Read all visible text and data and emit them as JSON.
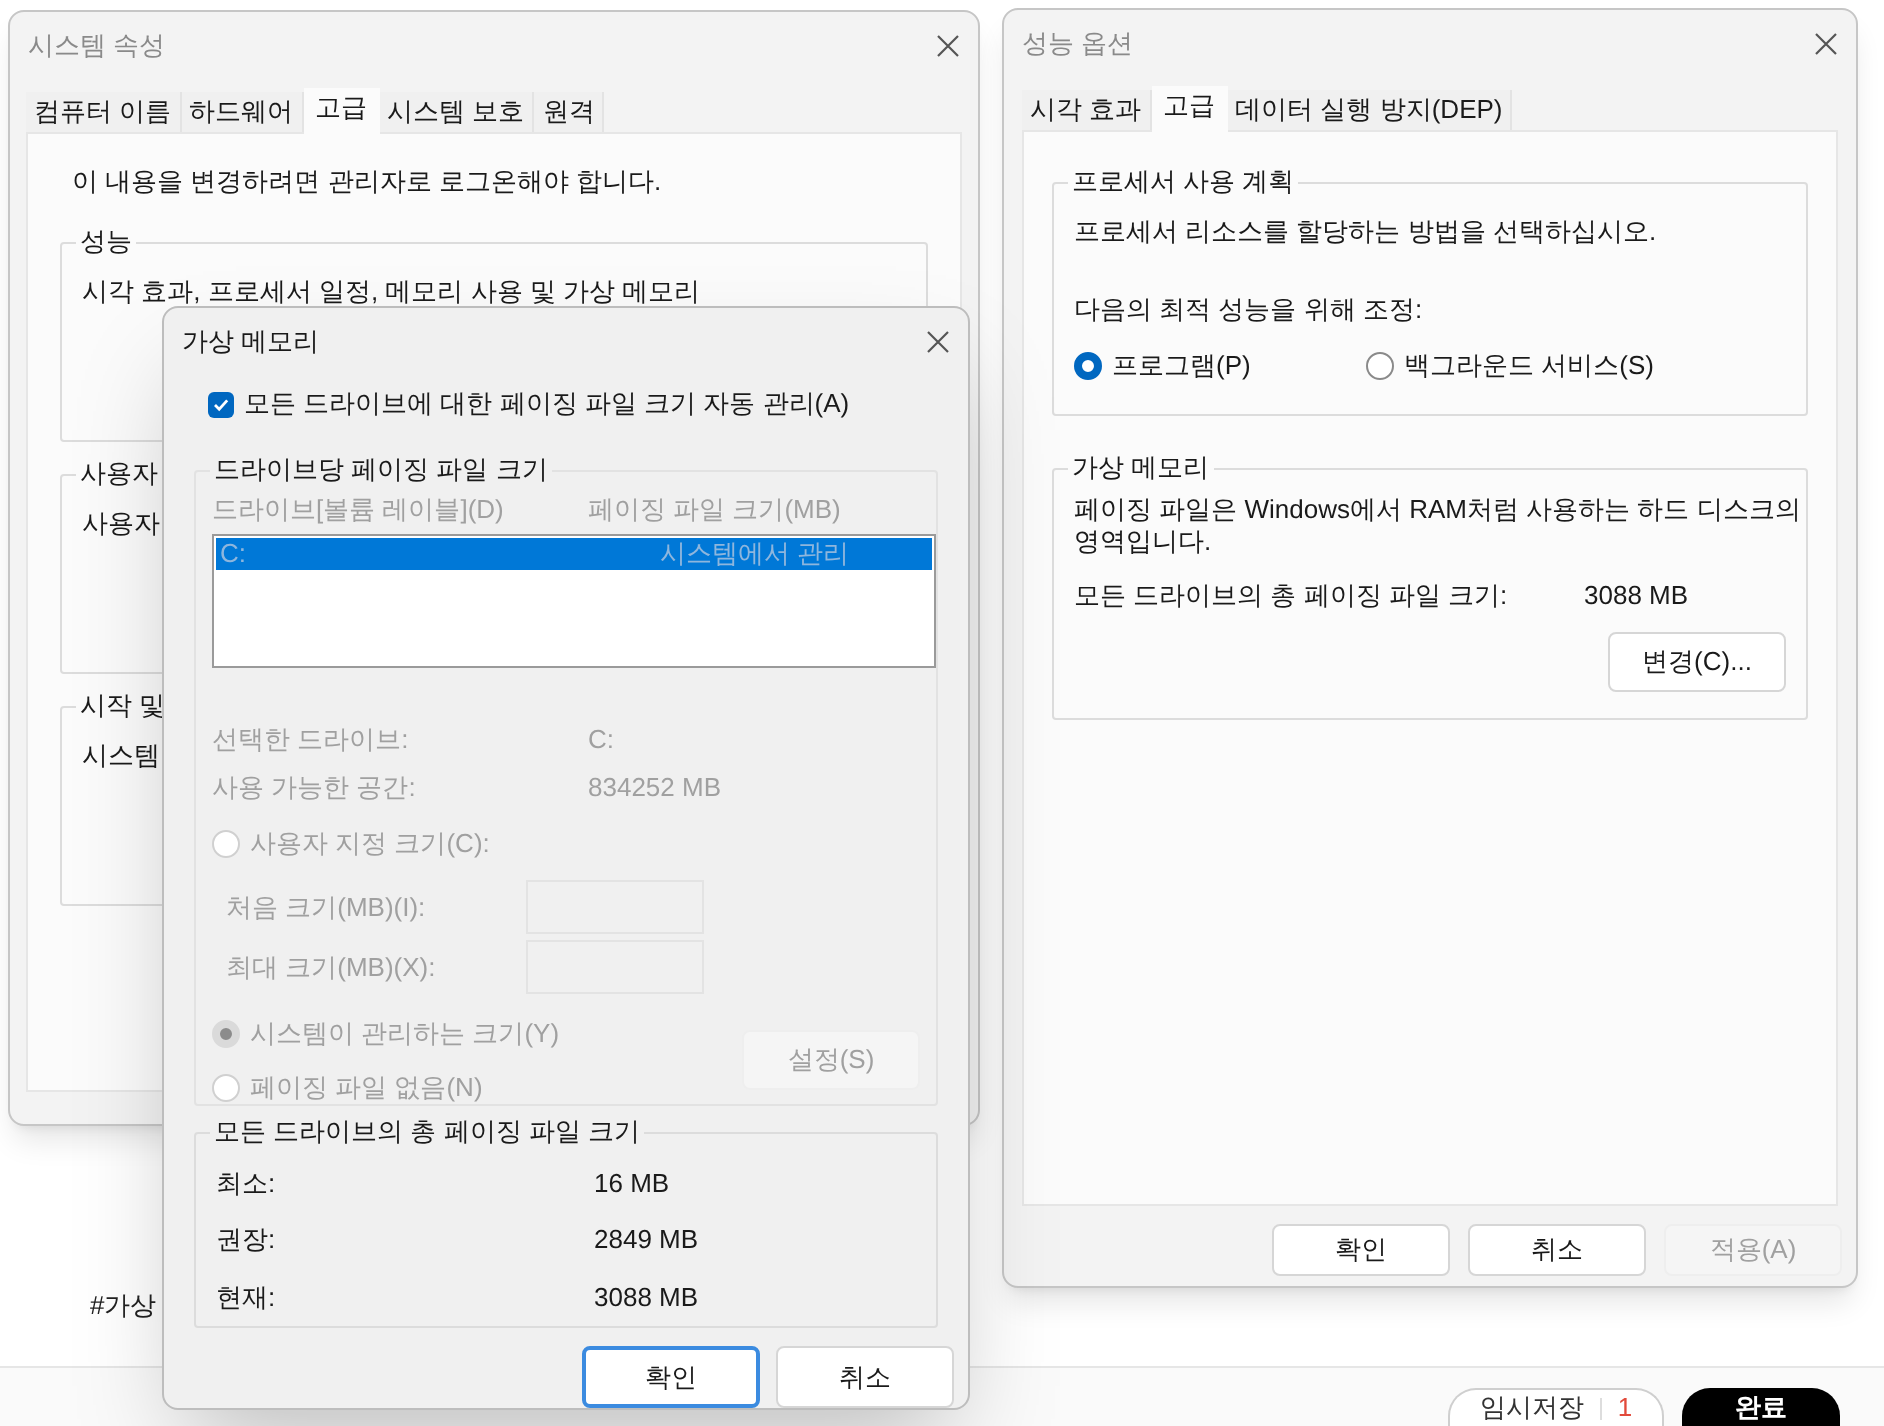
{
  "background": {
    "tag": "#가상",
    "temp_save": "임시저장",
    "temp_count": "1",
    "done": "완료"
  },
  "system_properties": {
    "title": "시스템 속성",
    "active": false,
    "tabs": [
      {
        "label": "컴퓨터 이름",
        "selected": false
      },
      {
        "label": "하드웨어",
        "selected": false
      },
      {
        "label": "고급",
        "selected": true
      },
      {
        "label": "시스템 보호",
        "selected": false
      },
      {
        "label": "원격",
        "selected": false
      }
    ],
    "notice": "이 내용을 변경하려면 관리자로 로그온해야 합니다.",
    "groups": [
      {
        "title": "성능",
        "text": "시각 효과, 프로세서 일정, 메모리 사용 및 가상 메모리"
      },
      {
        "title": "사용자",
        "text": "사용자"
      },
      {
        "title": "시작 및",
        "text": "시스템"
      }
    ]
  },
  "performance_options": {
    "title": "성능 옵션",
    "active": false,
    "tabs": [
      {
        "label": "시각 효과",
        "selected": false
      },
      {
        "label": "고급",
        "selected": true
      },
      {
        "label": "데이터 실행 방지(DEP)",
        "selected": false
      }
    ],
    "processor": {
      "title": "프로세서 사용 계획",
      "text": "프로세서 리소스를 할당하는 방법을 선택하십시오.",
      "adjust_label": "다음의 최적 성능을 위해 조정:",
      "options": [
        {
          "label": "프로그램(P)",
          "selected": true
        },
        {
          "label": "백그라운드 서비스(S)",
          "selected": false
        }
      ]
    },
    "virtual_memory": {
      "title": "가상 메모리",
      "text": "페이징 파일은 Windows에서 RAM처럼 사용하는 하드 디스크의 영역입니다.",
      "total_label": "모든 드라이브의 총 페이징 파일 크기:",
      "total_value": "3088 MB",
      "button": "변경(C)..."
    },
    "buttons": [
      {
        "label": "확인",
        "disabled": false
      },
      {
        "label": "취소",
        "disabled": false
      },
      {
        "label": "적용(A)",
        "disabled": true
      }
    ]
  },
  "virtual_memory": {
    "title": "가상 메모리",
    "active": true,
    "auto_manage": {
      "label": "모든 드라이브에 대한 페이징 파일 크기 자동 관리(A)",
      "checked": true
    },
    "per_drive": {
      "title": "드라이브당 페이징 파일 크기",
      "disabled": true,
      "columns": [
        "드라이브[볼륨 레이블](D)",
        "페이징 파일 크기(MB)"
      ],
      "rows": [
        {
          "drive": "C:",
          "size": "시스템에서 관리",
          "selected": true
        }
      ],
      "info": [
        {
          "label": "선택한 드라이브:",
          "value": "C:"
        },
        {
          "label": "사용 가능한 공간:",
          "value": "834252 MB"
        }
      ],
      "custom": {
        "label": "사용자 지정 크기(C):",
        "selected": false
      },
      "fields": [
        {
          "label": "처음 크기(MB)(I):"
        },
        {
          "label": "최대 크기(MB)(X):"
        }
      ],
      "options": [
        {
          "label": "시스템이 관리하는 크기(Y)",
          "selected": true
        },
        {
          "label": "페이징 파일 없음(N)",
          "selected": false
        }
      ],
      "set_button": "설정(S)"
    },
    "totals": {
      "title": "모든 드라이브의 총 페이징 파일 크기",
      "rows": [
        {
          "label": "최소:",
          "value": "16 MB"
        },
        {
          "label": "권장:",
          "value": "2849 MB"
        },
        {
          "label": "현재:",
          "value": "3088 MB"
        }
      ]
    },
    "buttons": [
      {
        "label": "확인",
        "default": true
      },
      {
        "label": "취소",
        "default": false
      }
    ]
  }
}
